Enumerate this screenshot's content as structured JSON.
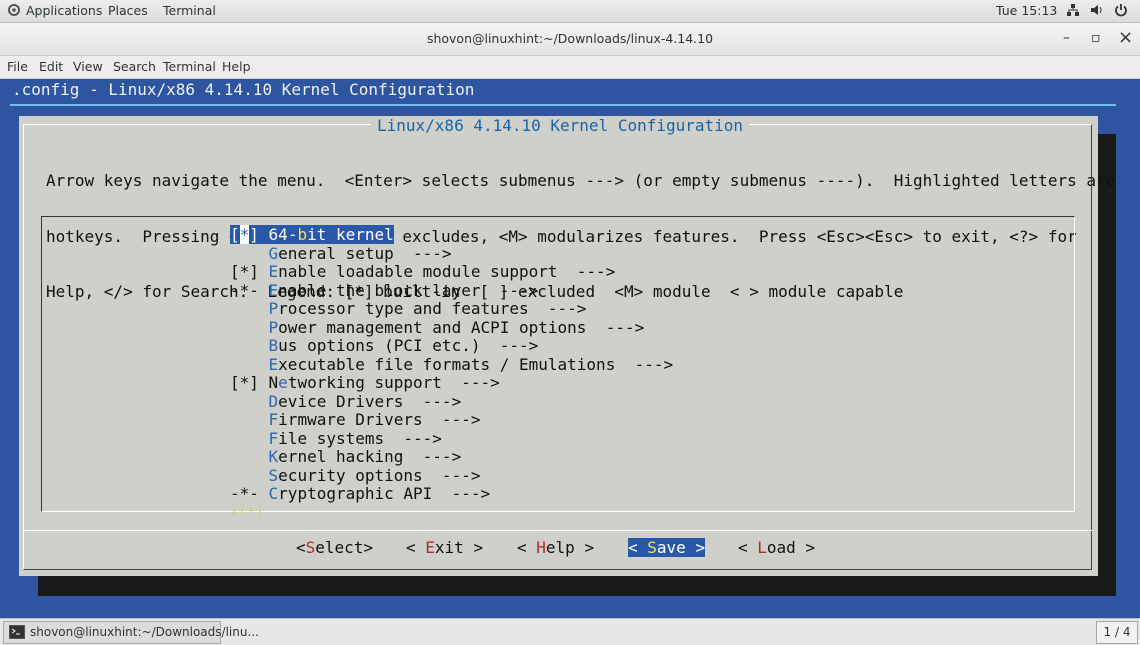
{
  "top_panel": {
    "applications": "Applications",
    "places": "Places",
    "terminal": "Terminal",
    "clock": "Tue 15:13"
  },
  "window": {
    "title": "shovon@linuxhint:~/Downloads/linux-4.14.10",
    "minimize": "–",
    "maximize": "▫",
    "close": "×"
  },
  "menubar": {
    "file": "File",
    "edit": "Edit",
    "view": "View",
    "search": "Search",
    "terminal": "Terminal",
    "help": "Help"
  },
  "terminal": {
    "header": ".config - Linux/x86 4.14.10 Kernel Configuration",
    "dialog_title": "Linux/x86 4.14.10 Kernel Configuration",
    "help_lines": [
      "Arrow keys navigate the menu.  <Enter> selects submenus ---> (or empty submenus ----).  Highlighted letters are",
      "hotkeys.  Pressing <Y> includes, <N> excludes, <M> modularizes features.  Press <Esc><Esc> to exit, <?> for",
      "Help, </> for Search.  Legend: [*] built-in  [ ] excluded  <M> module  < > module capable"
    ],
    "menu_items": [
      {
        "prefix": "[*] ",
        "pre": "64-",
        "hotkey": "b",
        "rest": "it kernel",
        "selected": true
      },
      {
        "prefix": "    ",
        "pre": "",
        "hotkey": "G",
        "rest": "eneral setup  --->"
      },
      {
        "prefix": "[*] ",
        "pre": "",
        "hotkey": "E",
        "rest": "nable loadable module support  --->"
      },
      {
        "prefix": "-*- ",
        "pre": "",
        "hotkey": "E",
        "rest": "nable the block layer  --->"
      },
      {
        "prefix": "    ",
        "pre": "",
        "hotkey": "P",
        "rest": "rocessor type and features  --->"
      },
      {
        "prefix": "    ",
        "pre": "",
        "hotkey": "P",
        "rest": "ower management and ACPI options  --->"
      },
      {
        "prefix": "    ",
        "pre": "",
        "hotkey": "B",
        "rest": "us options (PCI etc.)  --->"
      },
      {
        "prefix": "    ",
        "pre": "",
        "hotkey": "E",
        "rest": "xecutable file formats / Emulations  --->"
      },
      {
        "prefix": "[*] ",
        "pre": "N",
        "hotkey": "e",
        "rest": "tworking support  --->"
      },
      {
        "prefix": "    ",
        "pre": "",
        "hotkey": "D",
        "rest": "evice Drivers  --->"
      },
      {
        "prefix": "    ",
        "pre": "",
        "hotkey": "F",
        "rest": "irmware Drivers  --->"
      },
      {
        "prefix": "    ",
        "pre": "",
        "hotkey": "F",
        "rest": "ile systems  --->"
      },
      {
        "prefix": "    ",
        "pre": "",
        "hotkey": "K",
        "rest": "ernel hacking  --->"
      },
      {
        "prefix": "    ",
        "pre": "",
        "hotkey": "S",
        "rest": "ecurity options  --->"
      },
      {
        "prefix": "-*- ",
        "pre": "",
        "hotkey": "C",
        "rest": "ryptographic API  --->"
      }
    ],
    "more_indicator": "↓(+)",
    "buttons": {
      "select": {
        "open": "<",
        "hotkey": "S",
        "rest": "elect>"
      },
      "exit": {
        "open": "< ",
        "hotkey": "E",
        "rest": "xit >"
      },
      "help": {
        "open": "< ",
        "hotkey": "H",
        "rest": "elp >"
      },
      "save": {
        "open": "< ",
        "hotkey": "S",
        "rest": "ave >"
      },
      "load": {
        "open": "< ",
        "hotkey": "L",
        "rest": "oad >"
      }
    }
  },
  "taskbar": {
    "task_label": "shovon@linuxhint:~/Downloads/linu...",
    "workspace": "1 / 4"
  }
}
